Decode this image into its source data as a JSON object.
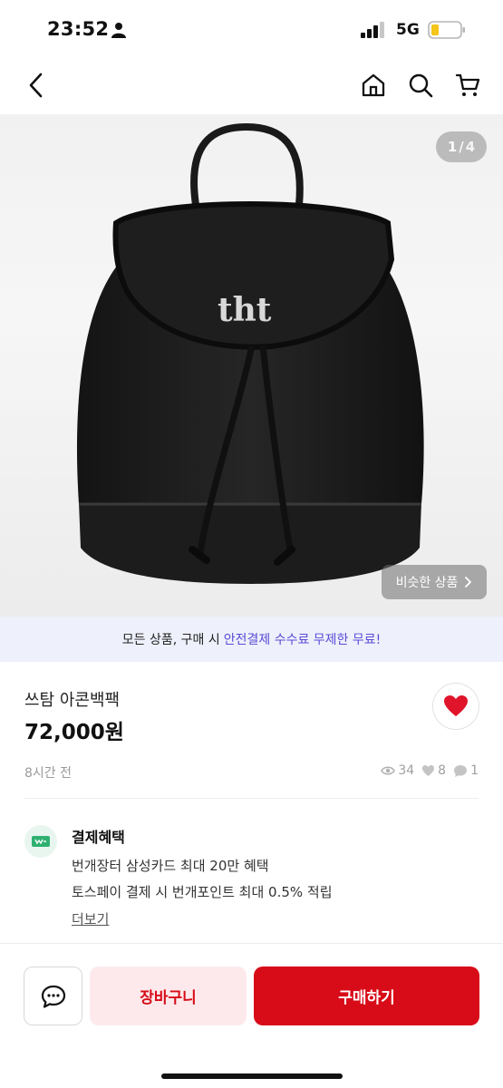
{
  "status_bar": {
    "time": "23:52",
    "network": "5G",
    "icons": [
      "person-icon",
      "signal-icon",
      "battery-icon"
    ]
  },
  "nav": {
    "icons": [
      "back-icon",
      "home-icon",
      "search-icon",
      "cart-icon"
    ]
  },
  "image": {
    "current": "1",
    "separator": "/",
    "total": "4",
    "similar_label": "비슷한 상품",
    "similar_icon": "chevron-right-icon"
  },
  "promo": {
    "text": "모든 상품, 구매 시",
    "highlight": "안전결제 수수료 무제한 무료!",
    "accent_color": "#5a4ad6"
  },
  "product": {
    "name": "쓰탐 아콘백팩",
    "price": "72,000원",
    "time_ago": "8시간 전",
    "views": "34",
    "likes": "8",
    "chats": "1",
    "favorite_icon": "heart-icon",
    "favorite_color": "#e0142b"
  },
  "benefits": {
    "title": "결제혜택",
    "lines": [
      "번개장터 삼성카드 최대 20만 혜택",
      "토스페이 결제 시 번개포인트 최대 0.5% 적립"
    ],
    "more": "더보기",
    "icon": "payment-icon"
  },
  "actions": {
    "chat_icon": "chat-icon",
    "cart_label": "장바구니",
    "buy_label": "구매하기",
    "brand_color": "#d80c18"
  }
}
